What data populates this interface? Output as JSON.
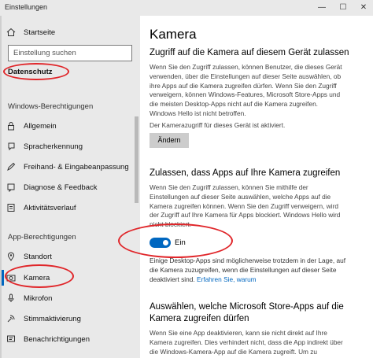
{
  "window": {
    "title": "Einstellungen"
  },
  "sidebar": {
    "home_label": "Startseite",
    "search_placeholder": "Einstellung suchen",
    "category": "Datenschutz",
    "section1": "Windows-Berechtigungen",
    "items1": [
      {
        "label": "Allgemein",
        "icon": "lock-icon"
      },
      {
        "label": "Spracherkennung",
        "icon": "speech-icon"
      },
      {
        "label": "Freihand- & Eingabeanpassung",
        "icon": "pen-icon"
      },
      {
        "label": "Diagnose & Feedback",
        "icon": "feedback-icon"
      },
      {
        "label": "Aktivitätsverlauf",
        "icon": "history-icon"
      }
    ],
    "section2": "App-Berechtigungen",
    "items2": [
      {
        "label": "Standort",
        "icon": "location-icon"
      },
      {
        "label": "Kamera",
        "icon": "camera-icon"
      },
      {
        "label": "Mikrofon",
        "icon": "microphone-icon"
      },
      {
        "label": "Stimmaktivierung",
        "icon": "voice-activation-icon"
      },
      {
        "label": "Benachrichtigungen",
        "icon": "notification-icon"
      }
    ]
  },
  "main": {
    "title": "Kamera",
    "section1": {
      "heading": "Zugriff auf die Kamera auf diesem Gerät zulassen",
      "lines": [
        "Wenn Sie den Zugriff zulassen, können Benutzer, die dieses Gerät",
        "verwenden, über die Einstellungen auf dieser Seite auswählen, ob",
        "ihre Apps auf die Kamera zugreifen dürfen. Wenn Sie den Zugriff",
        "verweigern, können Windows-Features, Microsoft Store-Apps und",
        "die meisten Desktop-Apps nicht auf die Kamera zugreifen.",
        "Windows Hello ist nicht betroffen."
      ],
      "status": "Der Kamerazugriff für dieses Gerät ist aktiviert.",
      "button": "Ändern"
    },
    "section2": {
      "heading": "Zulassen, dass Apps auf Ihre Kamera zugreifen",
      "lines": [
        "Wenn Sie den Zugriff zulassen, können Sie mithilfe der",
        "Einstellungen auf dieser Seite auswählen, welche Apps auf die",
        "Kamera zugreifen können. Wenn Sie den Zugriff verweigern, wird",
        "der Zugriff auf Ihre Kamera für Apps blockiert. Windows Hello wird",
        "nicht blockiert."
      ],
      "toggle_label": "Ein",
      "toggle_on": true,
      "note_lines": [
        "Einige Desktop-Apps sind möglicherweise trotzdem in der Lage, auf",
        "die Kamera zuzugreifen, wenn die Einstellungen auf dieser Seite",
        "deaktiviert sind."
      ],
      "note_link": "Erfahren Sie, warum"
    },
    "section3": {
      "heading_lines": [
        "Auswählen, welche Microsoft Store-Apps auf die",
        "Kamera zugreifen dürfen"
      ],
      "lines": [
        "Wenn Sie eine App deaktivieren, kann sie nicht direkt auf Ihre",
        "Kamera zugreifen. Dies verhindert nicht, dass die App indirekt über",
        "die Windows-Kamera-App auf die Kamera zugreift. Um zu"
      ]
    }
  },
  "colors": {
    "accent": "#0067c0",
    "annotation": "#e0262a",
    "sidebar_bg": "#e9e9e9"
  }
}
